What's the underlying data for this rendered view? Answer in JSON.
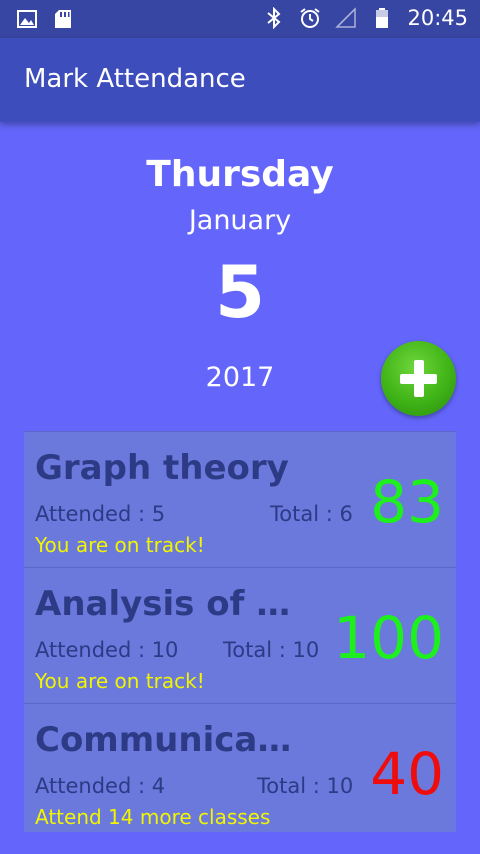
{
  "status_bar": {
    "time": "20:45"
  },
  "toolbar": {
    "title": "Mark Attendance"
  },
  "date": {
    "weekday": "Thursday",
    "month": "January",
    "day": "5",
    "year": "2017"
  },
  "fab": {
    "icon": "plus-icon",
    "color": "#3fb317"
  },
  "subjects": [
    {
      "name": "Graph theory",
      "attended": "Attended : 5",
      "total": "Total : 6",
      "percent": "83",
      "status": "You are on track!",
      "percent_color": "#1ef01e"
    },
    {
      "name": "Analysis of Al…",
      "attended": "Attended : 10",
      "total": "Total : 10",
      "percent": "100",
      "status": "You are on track!",
      "percent_color": "#1ef01e"
    },
    {
      "name": "Communication",
      "attended": "Attended : 4",
      "total": "Total : 10",
      "percent": "40",
      "status": "Attend 14 more classes",
      "percent_color": "#ee0c0c"
    }
  ],
  "colors": {
    "background": "#6466fb",
    "toolbar": "#3d4dbb",
    "card": "#6a79db",
    "status_text": "#f1f500"
  }
}
